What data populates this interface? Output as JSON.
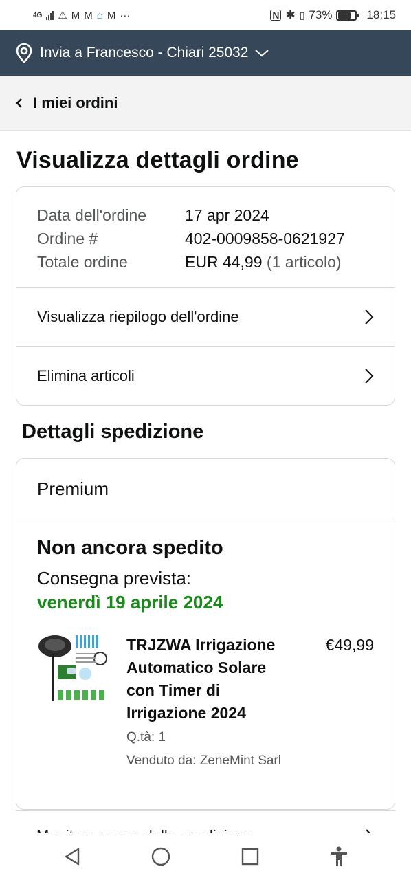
{
  "status_bar": {
    "network": "4G",
    "battery_percent": "73%",
    "battery_level": 0.73,
    "time": "18:15",
    "icons": [
      "signal-icon",
      "warning-icon",
      "gmail-icon",
      "gmail-icon",
      "home-icon",
      "gmail-icon",
      "more-icon",
      "nfc-icon",
      "bluetooth-icon",
      "vibrate-icon",
      "battery-icon"
    ]
  },
  "delivery": {
    "text": "Invia a Francesco - Chiari 25032"
  },
  "back_header": {
    "label": "I miei ordini"
  },
  "page_title": "Visualizza dettagli ordine",
  "order": {
    "date_label": "Data dell'ordine",
    "date_value": "17 apr 2024",
    "number_label": "Ordine #",
    "number_value": "402-0009858-0621927",
    "total_label": "Totale ordine",
    "total_value": "EUR 44,99",
    "total_count": "(1 articolo)",
    "links": {
      "summary": "Visualizza riepilogo dell'ordine",
      "delete": "Elimina articoli"
    }
  },
  "shipping": {
    "section_title": "Dettagli spedizione",
    "tier": "Premium",
    "status": "Non ancora spedito",
    "eta_label": "Consegna prevista:",
    "eta_date": "venerdì 19 aprile 2024",
    "item": {
      "title": "TRJZWA Irrigazione Automatico Solare con Timer di Irrigazione 2024",
      "price": "€49,99",
      "qty": "Q.tà: 1",
      "seller": "Venduto da: ZeneMint Sarl"
    },
    "next_row_partial": "Monitora pacco della spedizione"
  },
  "colors": {
    "header_bg": "#37475a",
    "eta_green": "#1a8a1a",
    "muted": "#565959"
  }
}
